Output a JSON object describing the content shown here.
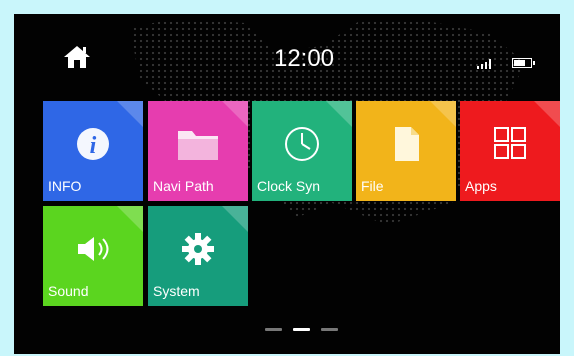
{
  "status_bar": {
    "time": "12:00",
    "home_icon": "home-icon",
    "signal_icon": "signal-icon",
    "battery_icon": "battery-icon"
  },
  "tiles": [
    {
      "id": "info",
      "label": "INFO",
      "icon": "info-icon",
      "color": "#2f67e6"
    },
    {
      "id": "navi_path",
      "label": "Navi Path",
      "icon": "folder-icon",
      "color": "#e63daf"
    },
    {
      "id": "clock_syn",
      "label": "Clock Syn",
      "icon": "clock-icon",
      "color": "#22b27c"
    },
    {
      "id": "file",
      "label": "File",
      "icon": "file-icon",
      "color": "#f2b41a"
    },
    {
      "id": "apps",
      "label": "Apps",
      "icon": "grid-icon",
      "color": "#ee1a1e"
    },
    {
      "id": "sound",
      "label": "Sound",
      "icon": "speaker-icon",
      "color": "#5bd51f"
    },
    {
      "id": "system",
      "label": "System",
      "icon": "gear-icon",
      "color": "#169d7c"
    }
  ],
  "pager": {
    "pages": 3,
    "active_index": 1
  }
}
